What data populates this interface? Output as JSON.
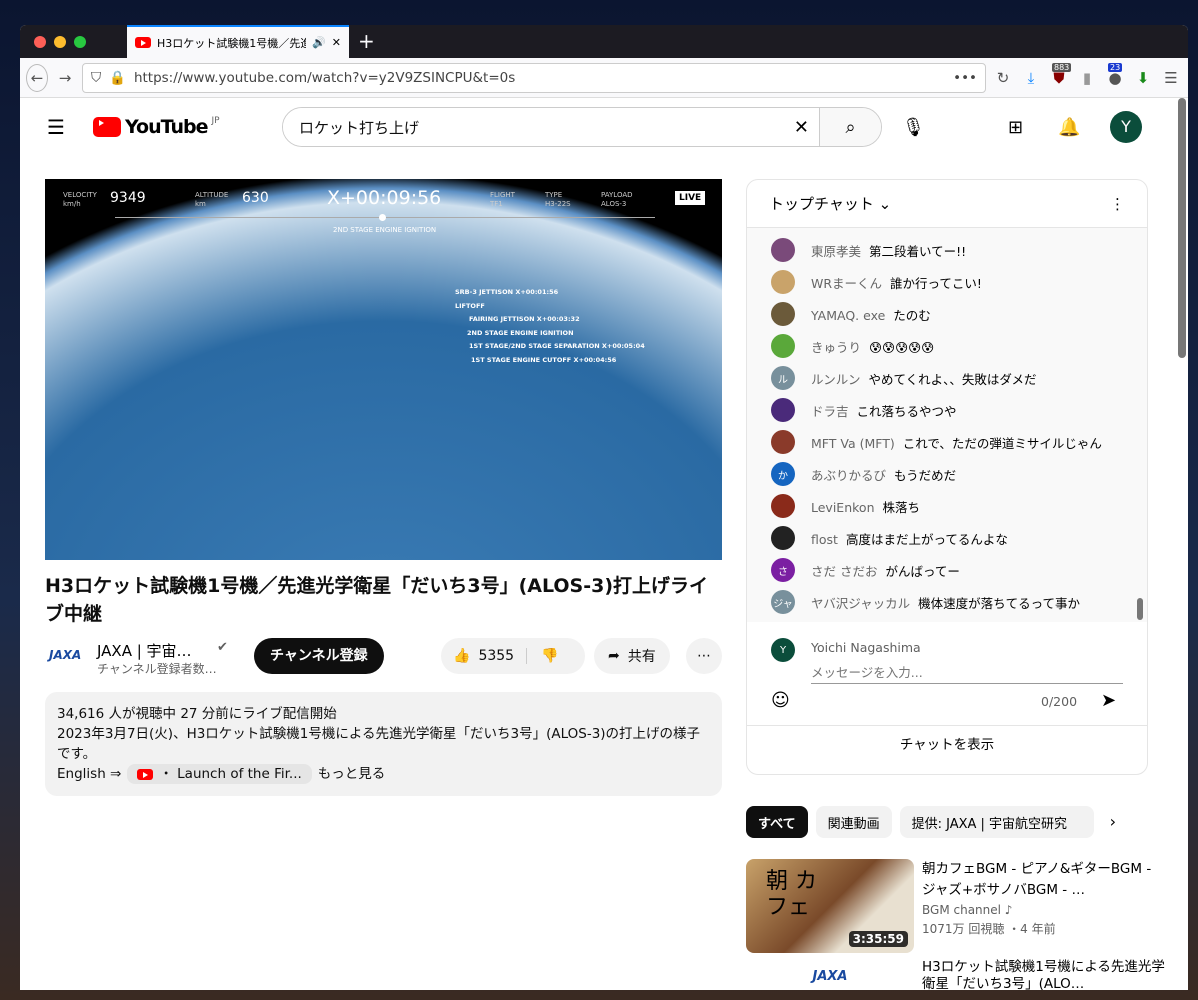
{
  "browser": {
    "tab_title": "H3ロケット試験機1号機／先進光",
    "url": "https://www.youtube.com/watch?v=y2V9ZSINCPU&t=0s",
    "badge1": "883",
    "badge2": "23"
  },
  "masthead": {
    "logo": "YouTube",
    "region": "JP",
    "search_value": "ロケット打ち上げ",
    "avatar": "Y"
  },
  "player": {
    "velocity_label": "VELOCITY",
    "velocity_unit": "km/h",
    "velocity": "9349",
    "altitude_label": "ALTITUDE",
    "altitude_unit": "km",
    "altitude": "630",
    "timer": "X+00:09:56",
    "flight_label": "FLIGHT",
    "flight": "TF1",
    "type_label": "TYPE",
    "type": "H3-22S",
    "payload_label": "PAYLOAD",
    "payload": "ALOS-3",
    "live": "LIVE",
    "current_event": "2ND STAGE ENGINE IGNITION",
    "events": [
      "SRB-3 JETTISON X+00:01:56",
      "LIFTOFF",
      "FAIRING JETTISON X+00:03:32",
      "2ND STAGE ENGINE IGNITION",
      "1ST STAGE/2ND STAGE SEPARATION X+00:05:04",
      "1ST STAGE ENGINE CUTOFF X+00:04:56"
    ]
  },
  "video": {
    "title": "H3ロケット試験機1号機／先進光学衛星「だいち3号」(ALOS-3)打上げライブ中継",
    "channel": "JAXA | 宇宙…",
    "subscribers": "チャンネル登録者数…",
    "subscribe": "チャンネル登録",
    "likes": "5355",
    "share": "共有",
    "desc_stats": "34,616 人が視聴中  27 分前にライブ配信開始",
    "desc_text": "2023年3月7日(火)、H3ロケット試験機1号機による先進光学衛星「だいち3号」(ALOS-3)の打上げの様子です。",
    "desc_english": "English ⇒",
    "desc_link": "・ Launch of the Fir...",
    "more": "もっと見る"
  },
  "chat": {
    "title": "トップチャット",
    "messages": [
      {
        "author": "東原孝美",
        "text": "第二段着いてー!!",
        "color": "#7a4a7a"
      },
      {
        "author": "WRまーくん",
        "text": "誰か行ってこい!",
        "color": "#c9a36a"
      },
      {
        "author": "YAMAQ. exe",
        "text": "たのむ",
        "color": "#6b5a3a"
      },
      {
        "author": "きゅうり",
        "text": "😰😰😰😰😰",
        "color": "#5aa83a"
      },
      {
        "author": "ルンルン",
        "text": "やめてくれよ、、失敗はダメだ",
        "color": "#78909c",
        "initial": "ル"
      },
      {
        "author": "ドラ吉",
        "text": "これ落ちるやつや",
        "color": "#4a2a7a"
      },
      {
        "author": "MFT Va (MFT)",
        "text": "これで、ただの弾道ミサイルじゃん",
        "color": "#8a3a2a"
      },
      {
        "author": "あぶりかるび",
        "text": "もうだめだ",
        "color": "#1565c0",
        "initial": "か"
      },
      {
        "author": "LeviEnkon",
        "text": "株落ち",
        "color": "#8a2a1a"
      },
      {
        "author": "flost",
        "text": "高度はまだ上がってるんよな",
        "color": "#222"
      },
      {
        "author": "さだ さだお",
        "text": "がんばってー",
        "color": "#7b1fa2",
        "initial": "さ"
      },
      {
        "author": "ヤバ沢ジャッカル",
        "text": "機体速度が落ちてるって事か",
        "color": "#78909c",
        "initial": "ジャ"
      }
    ],
    "user": "Yoichi Nagashima",
    "user_initial": "Y",
    "placeholder": "メッセージを入力...",
    "counter": "0/200",
    "show_chat": "チャットを表示"
  },
  "chips": [
    "すべて",
    "関連動画",
    "提供: JAXA | 宇宙航空研究"
  ],
  "related": [
    {
      "title": "朝カフェBGM - ピアノ&ギターBGM - ジャズ+ボサノバBGM - …",
      "channel": "BGM channel ♪",
      "meta": "1071万 回視聴 ・4 年前",
      "duration": "3:35:59",
      "thumb_text": "朝 カフェ"
    },
    {
      "title": "H3ロケット試験機1号機による先進光学衛星「だいち3号」(ALO…",
      "thumb_text": "JAXA"
    }
  ]
}
